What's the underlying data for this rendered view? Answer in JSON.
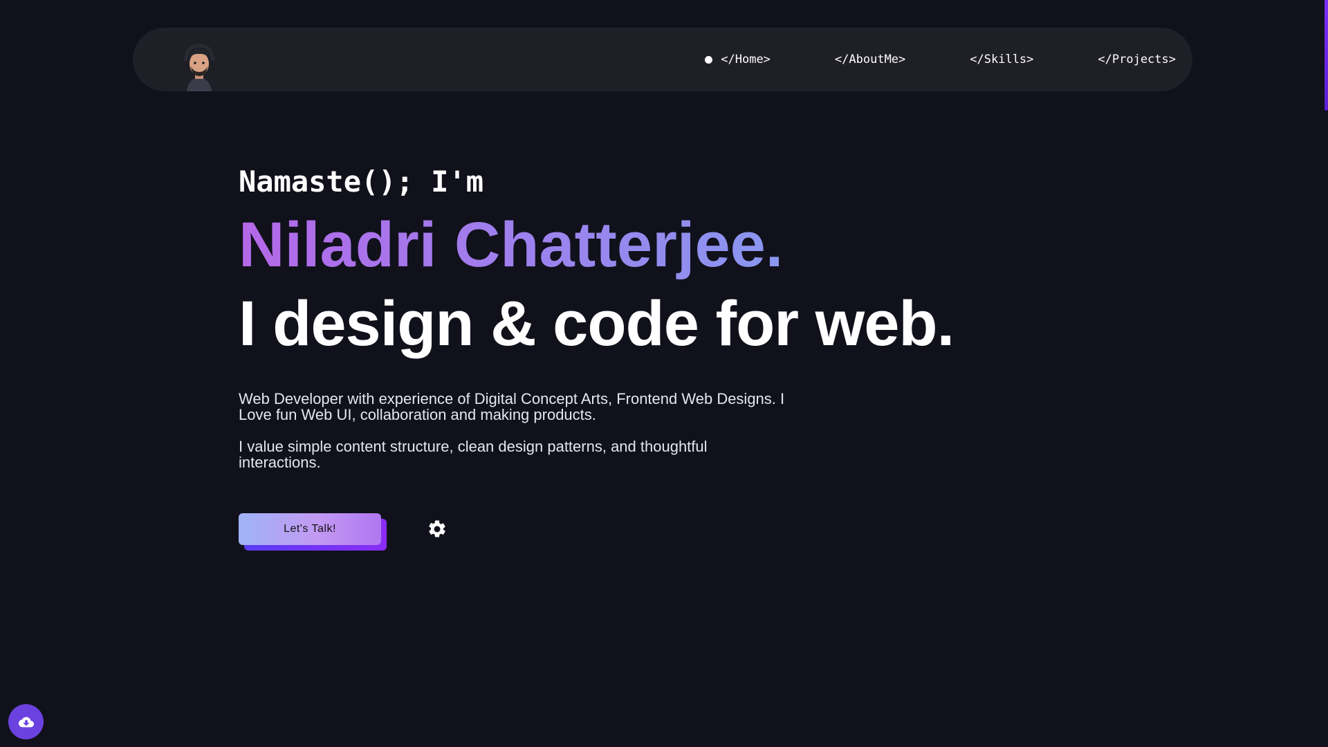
{
  "nav": {
    "items": [
      {
        "label": "</Home>",
        "active": true
      },
      {
        "label": "</AboutMe>",
        "active": false
      },
      {
        "label": "</Skills>",
        "active": false
      },
      {
        "label": "</Projects>",
        "active": false
      }
    ],
    "avatar_icon": "avatar-portrait-icon"
  },
  "hero": {
    "greeting": "Namaste(); I'm",
    "name": "Niladri Chatterjee.",
    "tagline": "I design & code for web.",
    "bio": [
      "Web Developer with experience of Digital Concept Arts, Frontend Web Designs. I Love fun Web UI, collaboration and making products.",
      "I value simple content structure, clean design patterns, and thoughtful interactions."
    ]
  },
  "actions": {
    "talk_label": "Let's Talk!",
    "settings_icon": "gear-icon"
  },
  "fab": {
    "icon": "cloud-download-icon"
  },
  "colors": {
    "background": "#11111c",
    "navbar": "#1f1f27",
    "accent": "#7b2ff7",
    "name_gradient_start": "#b468e8",
    "name_gradient_end": "#78a9f0"
  }
}
